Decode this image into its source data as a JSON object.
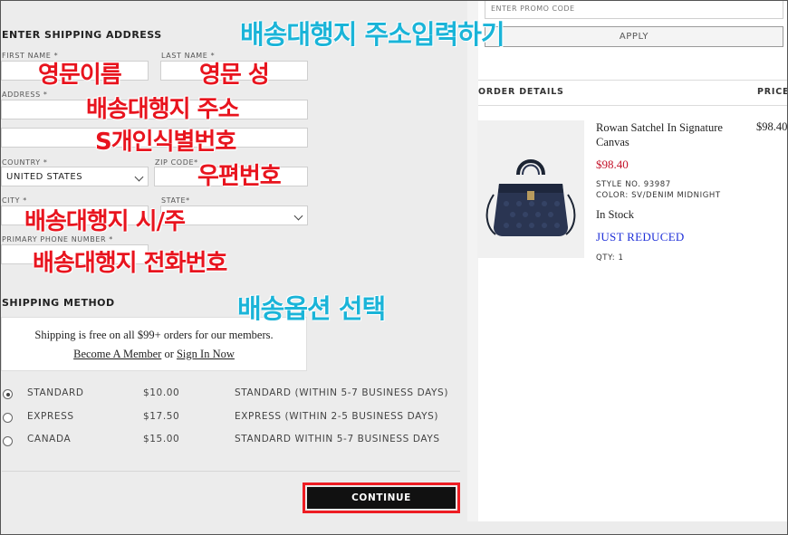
{
  "shipping_address": {
    "title": "ENTER SHIPPING ADDRESS",
    "first_name_label": "FIRST NAME *",
    "last_name_label": "LAST NAME *",
    "address_label": "ADDRESS *",
    "country_label": "COUNTRY *",
    "country_value": "UNITED STATES",
    "zip_label": "ZIP CODE*",
    "city_label": "CITY *",
    "state_label": "STATE*",
    "phone_label": "PRIMARY PHONE NUMBER *"
  },
  "annotations": {
    "header": "배송대행지 주소입력하기",
    "first_name": "영문이름",
    "last_name": "영문 성",
    "address": "배송대행지 주소",
    "address2": "S개인식별번호",
    "zip": "우편번호",
    "city_state": "배송대행지 시/주",
    "phone": "배송대행지 전화번호",
    "shipping": "배송옵션 선택"
  },
  "shipping_method": {
    "title": "SHIPPING METHOD",
    "promo_line": "Shipping is free on all $99+ orders for our members.",
    "become_member": "Become A Member",
    "or_text": "or",
    "sign_in": "Sign In Now",
    "options": [
      {
        "name": "STANDARD",
        "price": "$10.00",
        "desc": "STANDARD (WITHIN 5-7 BUSINESS DAYS)",
        "selected": true
      },
      {
        "name": "EXPRESS",
        "price": "$17.50",
        "desc": "EXPRESS (WITHIN 2-5 BUSINESS DAYS)",
        "selected": false
      },
      {
        "name": "CANADA",
        "price": "$15.00",
        "desc": "STANDARD WITHIN 5-7 BUSINESS DAYS",
        "selected": false
      }
    ]
  },
  "continue_label": "CONTINUE",
  "promo": {
    "placeholder": "ENTER PROMO CODE",
    "apply_label": "APPLY"
  },
  "order": {
    "details_label": "ORDER DETAILS",
    "price_label": "PRICE",
    "product": {
      "name": "Rowan Satchel In Signature Canvas",
      "sale_price": "$98.40",
      "list_price": "$98.40",
      "style": "STYLE NO. 93987",
      "color": "COLOR: SV/DENIM MIDNIGHT",
      "stock": "In Stock",
      "badge": "JUST REDUCED",
      "qty": "QTY: 1"
    }
  },
  "colors": {
    "annotation_red": "#e8141e",
    "annotation_cyan": "#1ab4d8",
    "sale_red": "#c4132a",
    "reduced_blue": "#1e2fd8"
  }
}
